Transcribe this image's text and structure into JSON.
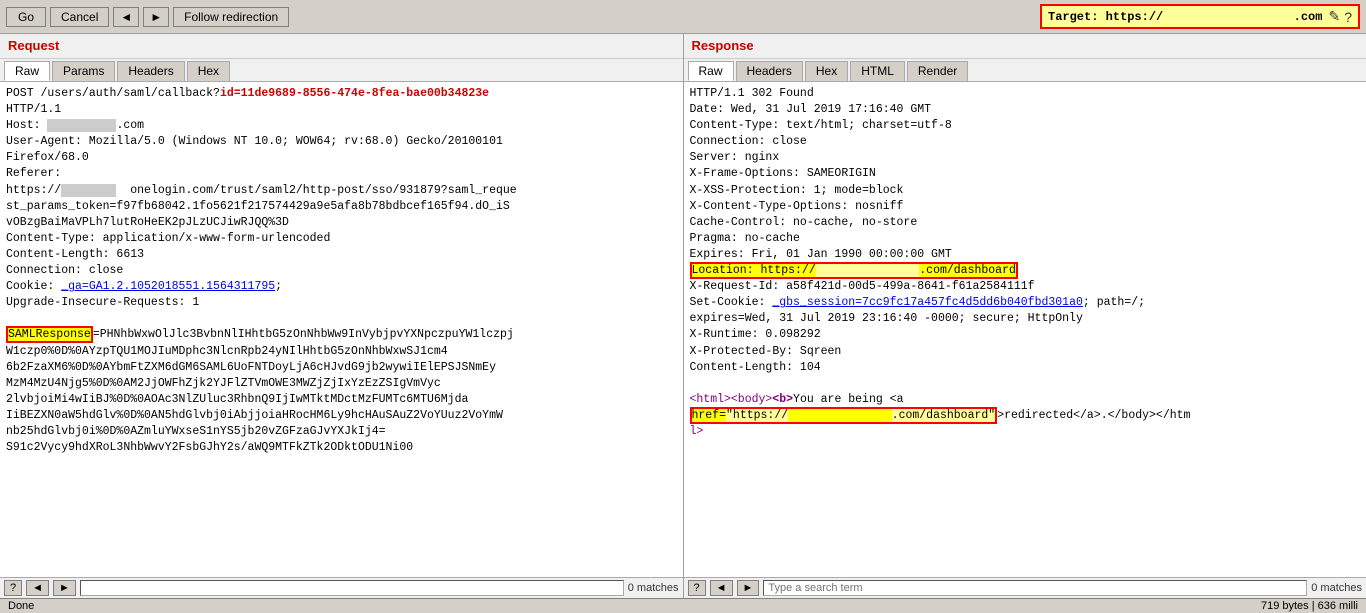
{
  "toolbar": {
    "go_label": "Go",
    "cancel_label": "Cancel",
    "nav_prev": "◄",
    "nav_next": "►",
    "follow_redirect_label": "Follow redirection",
    "target_label": "Target: https://",
    "target_suffix": ".com",
    "edit_icon": "✎",
    "help_icon": "?"
  },
  "request_panel": {
    "title": "Request",
    "tabs": [
      "Raw",
      "Params",
      "Headers",
      "Hex"
    ],
    "active_tab": "Raw",
    "content_line1": "POST /users/auth/saml/callback?",
    "content_id_highlight": "id=11de9689-8556-474e-8fea-bae00b34823e",
    "content_line2": "HTTP/1.1",
    "content_host_label": "Host: ",
    "content_host_blurred": "           .com",
    "content_useragent": "User-Agent: Mozilla/5.0 (Windows NT 10.0; WOW64; rv:68.0) Gecko/20100101",
    "content_firefox": "Firefox/68.0",
    "content_referer": "Referer:",
    "content_referer_url": "https://          onelogin.com/trust/saml2/http-post/sso/931879?saml_reque\nst_params_token=f97fb68042.1fo5621f217574429a9e5afa8b78bdbcef165f94.dO_iS\nvOBzgBaiMaVPLh7lutRoHeEK2pJLzUCJiwRJQQ%3D",
    "content_type": "Content-Type: application/x-www-form-urlencoded",
    "content_length": "Content-Length: 6613",
    "connection": "Connection: close",
    "cookie_label": "Cookie: ",
    "cookie_link": "_ga=GA1.2.1052018551.1564311795",
    "cookie_end": ";",
    "upgrade": "Upgrade-Insecure-Requests: 1",
    "saml_label": "SAMLResponse",
    "saml_value": "=PHNhbWxwOlJlc3BvbnNlIHhtbG5zOnNhbWw9InVybjpvYXNpczpuYW1lczpj\nW1czp0%0D%0AYzpTQU1MOJIuMDphc3NlcnRpb24yNIlHhtbG5zOnNhbWxwSJ1cm4\n6b2FzaXM6%0D%0AYbmFtZXM6dGM6SAML6UoFNTDoyLjA6cHJvdG9jb2wywiIElEPSJSNmEy\nMzM4MzU4Njg5%0D%0AM2JjOWFhZjk2YJFlZTVmOWE3MWZjZjIxYzEzZSIgVmVyc\n2lvbjoiMi4wIiBJ%0D%0AOAc3NlZUluc3RhbnQ9IjIwMTktMDctMzFUMTc6MTU6Mjda\nIBEZXN0aW5hdGlv%0D%0AN5hdGlvbj0iAbjjoiaHRocHM6Ly9hcHAuSAuZ2VoYUuZ2VoYUuz2VoYmW\nb25hdGlvbj0i%0D%0AZmluYWxseS1nYS5jb20vZGFzaGJvYXJkIj4=",
    "saml_more": "S91c2Vycy9hdXRoL3NhbWwvY2FsbGJhY2s/aWQ9MTFkZTk2ODktODU1Ni00",
    "footer_question": "?",
    "footer_prev": "◄",
    "footer_next": "►",
    "search_placeholder": "",
    "matches": "0 matches"
  },
  "response_panel": {
    "title": "Response",
    "tabs": [
      "Raw",
      "Headers",
      "Hex",
      "HTML",
      "Render"
    ],
    "active_tab": "Raw",
    "line_status": "HTTP/1.1 302 Found",
    "line_date": "Date: Wed, 31 Jul 2019 17:16:40 GMT",
    "line_contenttype": "Content-Type: text/html; charset=utf-8",
    "line_connection": "Connection: close",
    "line_server": "Server: nginx",
    "line_xframe": "X-Frame-Options: SAMEORIGIN",
    "line_xxss": "X-XSS-Protection: 1; mode=block",
    "line_xcontent": "X-Content-Type-Options: nosniff",
    "line_cache": "Cache-Control: no-cache, no-store",
    "line_pragma": "Pragma: no-cache",
    "line_expires": "Expires: Fri, 01 Jan 1990 00:00:00 GMT",
    "line_location_prefix": "Location: https://",
    "line_location_blurred": "               ",
    "line_location_suffix": ".com/dashboard",
    "line_xrequest": "X-Request-Id: a58f421d-00d5-499a-8641-f61a2584111f",
    "line_setcookie_label": "Set-Cookie: ",
    "line_setcookie_link": "_gbs_session=7cc9fc17a457fc4d5dd6b040fbd301a0",
    "line_setcookie_end": "; path=/;",
    "line_expires2": "expires=Wed, 31 Jul 2019 23:16:40 -0000; secure; HttpOnly",
    "line_runtime": "X-Runtime: 0.098292",
    "line_protected": "X-Protected-By: Sqreen",
    "line_contentlength": "Content-Length: 104",
    "html_open": "<html><body>",
    "html_bold_open": "<b>",
    "html_you_being": "You are being <a",
    "html_href_label": "href=",
    "html_href_value": "\"https://               .com/dashboard\"",
    "html_redirected": ">redirected</a>.</body></htm",
    "html_close": "l>",
    "footer_question": "?",
    "footer_prev": "◄",
    "footer_next": "►",
    "search_placeholder": "Type a search term",
    "matches": "0 matches"
  },
  "status_bar": {
    "done": "Done",
    "bytes": "719 bytes | 636 milli"
  }
}
